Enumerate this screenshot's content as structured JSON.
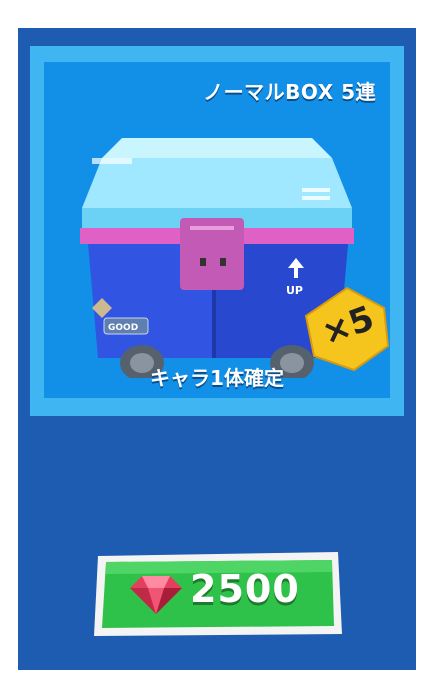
{
  "card": {
    "title": "ノーマルBOX 5連",
    "subtitle": "キャラ1体確定",
    "badge": "×5",
    "box_labels": {
      "arrow": "UP",
      "tag": "GOOD"
    }
  },
  "price": {
    "amount": "2500",
    "currency_icon": "ruby-gem-icon"
  },
  "colors": {
    "panel": "#1d5cb0",
    "card_frame": "#3fb5f2",
    "card_bg": "#1290e8",
    "button_green": "#2fc24a",
    "badge_yellow": "#f5c51d"
  }
}
